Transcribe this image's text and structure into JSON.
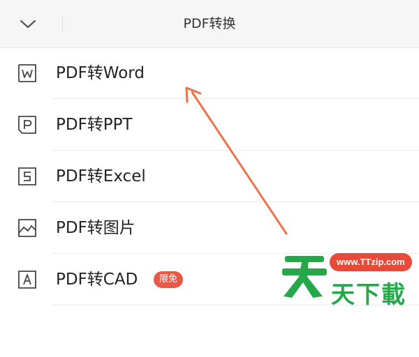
{
  "header": {
    "title": "PDF转换",
    "collapse_icon": "chevron-down-icon"
  },
  "items": [
    {
      "label": "PDF转Word",
      "icon": "word-doc-icon"
    },
    {
      "label": "PDF转PPT",
      "icon": "ppt-doc-icon"
    },
    {
      "label": "PDF转Excel",
      "icon": "excel-doc-icon"
    },
    {
      "label": "PDF转图片",
      "icon": "image-icon"
    },
    {
      "label": "PDF转CAD",
      "icon": "cad-doc-icon",
      "badge": "限免"
    }
  ],
  "watermark": {
    "url": "www.TTzip.com",
    "text": "天下載"
  },
  "colors": {
    "badge": "#e85a48",
    "arrow": "#e8744a",
    "watermark_green": "#26a84a",
    "watermark_red": "#e84a3a"
  }
}
